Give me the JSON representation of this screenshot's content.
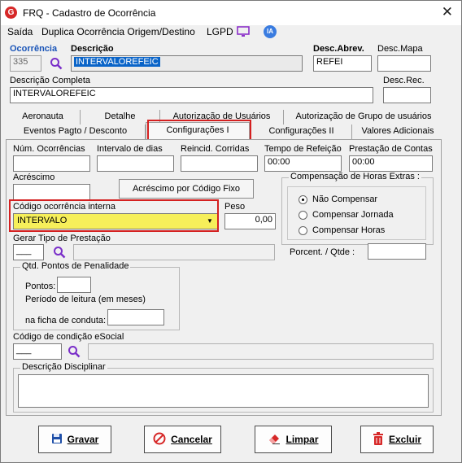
{
  "window": {
    "title": "FRQ - Cadastro de Ocorrência"
  },
  "menu": {
    "items": [
      "Saída",
      "Duplica Ocorrência Origem/Destino",
      "LGPD",
      "IA"
    ]
  },
  "header": {
    "ocorrencia_label": "Ocorrência",
    "ocorrencia_value": "335",
    "descricao_label": "Descrição",
    "descricao_value": "INTERVALOREFEIC",
    "desc_abrev_label": "Desc.Abrev.",
    "desc_abrev_value": "REFEI",
    "desc_mapa_label": "Desc.Mapa",
    "desc_mapa_value": "",
    "descricao_completa_label": "Descrição Completa",
    "descricao_completa_value": "INTERVALOREFEIC",
    "desc_rec_label": "Desc.Rec.",
    "desc_rec_value": ""
  },
  "tabs": {
    "row1": [
      "Aeronauta",
      "Detalhe",
      "Autorização de Usuários",
      "Autorização de Grupo de usuários"
    ],
    "row2": [
      "Eventos Pagto / Desconto",
      "Configurações I",
      "Configurações II",
      "Valores Adicionais"
    ]
  },
  "form": {
    "num_ocorrencias_label": "Núm. Ocorrências",
    "intervalo_dias_label": "Intervalo de dias",
    "reincid_corridas_label": "Reincid. Corridas",
    "tempo_refeicao_label": "Tempo de Refeição",
    "tempo_refeicao_value": "00:00",
    "prestacao_contas_label": "Prestação de Contas",
    "prestacao_contas_value": "00:00",
    "acrescimo_label": "Acréscimo",
    "acrescimo_button": "Acréscimo por Código Fixo",
    "codigo_interna_label": "Código ocorrência interna",
    "codigo_interna_value": "INTERVALO",
    "peso_label": "Peso",
    "peso_value": "0,00",
    "gerar_tipo_label": "Gerar Tipo de Prestação",
    "gerar_tipo_value": "___",
    "compensacao": {
      "title": "Compensação de Horas Extras :",
      "options": [
        "Não Compensar",
        "Compensar Jornada",
        "Compensar Horas"
      ],
      "selected": "Não Compensar"
    },
    "porcent_label": "Porcent. / Qtde :",
    "qtd_pontos": {
      "title": "Qtd. Pontos de Penalidade",
      "pontos_label": "Pontos:",
      "periodo_label": "Período de leitura (em meses)",
      "ficha_label": "na ficha de conduta:"
    },
    "codigo_esocial_label": "Código de condição eSocial",
    "codigo_esocial_value": "___",
    "descricao_disciplinar_label": "Descrição Disciplinar"
  },
  "buttons": {
    "gravar": "Gravar",
    "cancelar": "Cancelar",
    "limpar": "Limpar",
    "excluir": "Excluir"
  }
}
